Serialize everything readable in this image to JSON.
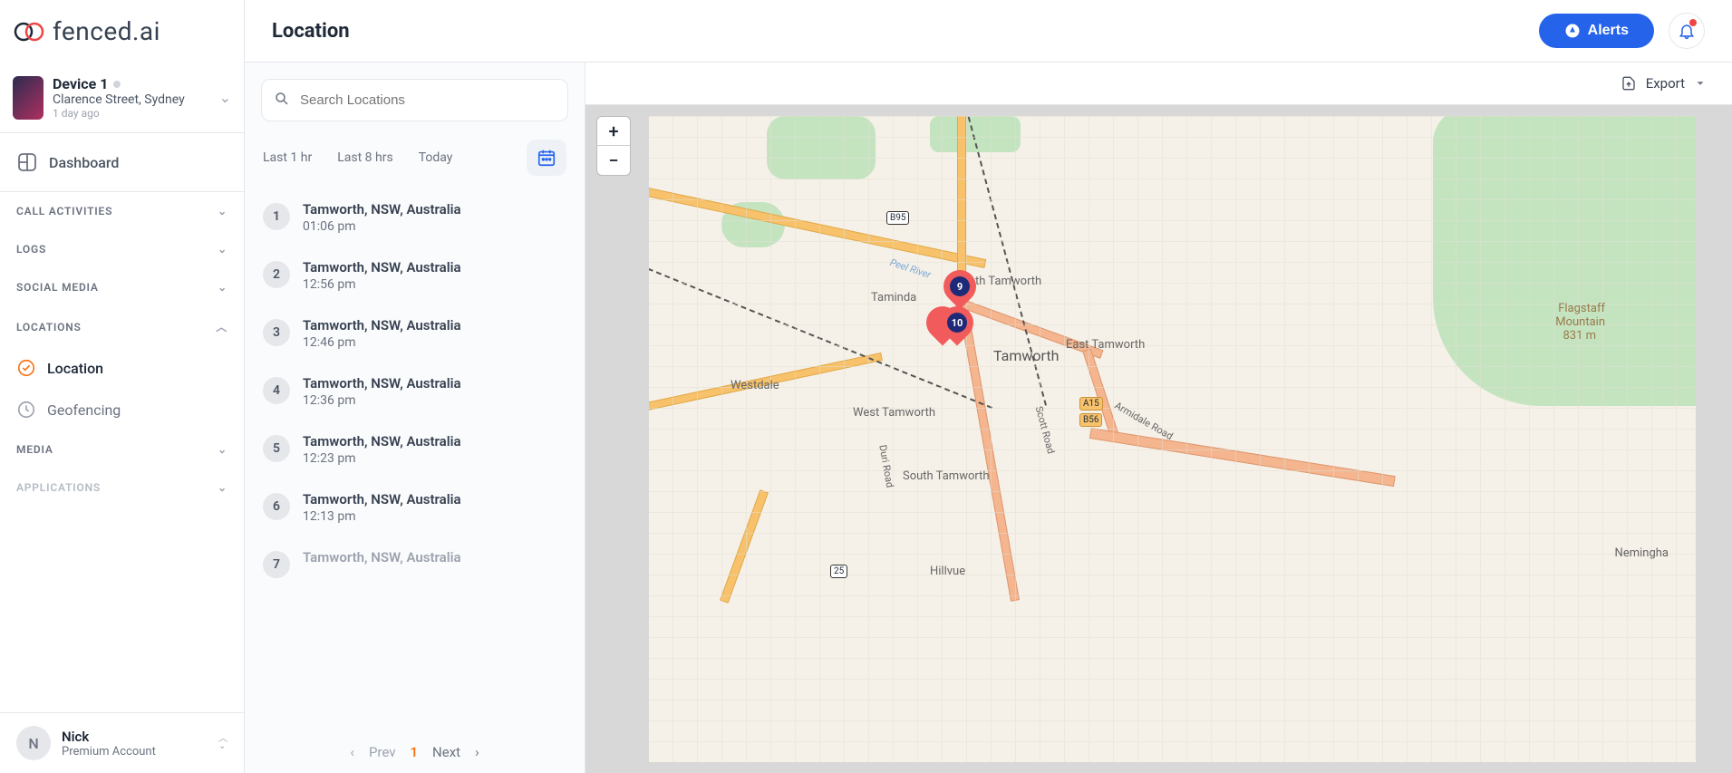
{
  "brand": "fenced.ai",
  "device": {
    "name": "Device 1",
    "location": "Clarence Street, Sydney",
    "lastSeen": "1 day ago"
  },
  "nav": {
    "dashboard": "Dashboard",
    "sections": {
      "call": "CALL ACTIVITIES",
      "logs": "LOGS",
      "social": "SOCIAL MEDIA",
      "locations": "LOCATIONS",
      "media": "MEDIA",
      "apps": "APPLICATIONS"
    },
    "sub": {
      "location": "Location",
      "geofencing": "Geofencing"
    }
  },
  "user": {
    "initial": "N",
    "name": "Nick",
    "plan": "Premium Account"
  },
  "page": {
    "title": "Location"
  },
  "topbar": {
    "alerts": "Alerts"
  },
  "search": {
    "placeholder": "Search Locations"
  },
  "filters": {
    "hr1": "Last 1 hr",
    "hr8": "Last 8 hrs",
    "today": "Today"
  },
  "locations": [
    {
      "idx": "1",
      "name": "Tamworth, NSW, Australia",
      "time": "01:06 pm"
    },
    {
      "idx": "2",
      "name": "Tamworth, NSW, Australia",
      "time": "12:56 pm"
    },
    {
      "idx": "3",
      "name": "Tamworth, NSW, Australia",
      "time": "12:46 pm"
    },
    {
      "idx": "4",
      "name": "Tamworth, NSW, Australia",
      "time": "12:36 pm"
    },
    {
      "idx": "5",
      "name": "Tamworth, NSW, Australia",
      "time": "12:23 pm"
    },
    {
      "idx": "6",
      "name": "Tamworth, NSW, Australia",
      "time": "12:13 pm"
    },
    {
      "idx": "7",
      "name": "Tamworth, NSW, Australia",
      "time": ""
    }
  ],
  "pager": {
    "prev": "Prev",
    "page": "1",
    "next": "Next"
  },
  "export": {
    "label": "Export"
  },
  "map": {
    "labels": {
      "tamworth": "Tamworth",
      "north": "th Tamworth",
      "east": "East Tamworth",
      "west": "West Tamworth",
      "south": "South Tamworth",
      "taminda": "Taminda",
      "westdale": "Westdale",
      "hillvue": "Hillvue",
      "neminga": "Nemingha",
      "flag1": "Flagstaff",
      "flag2": "Mountain",
      "flag3": "831 m",
      "scott": "Scott Road",
      "duri": "Duri Road",
      "river": "Peel River",
      "armidale": "Armidale Road"
    },
    "shields": {
      "b95": "B95",
      "r25": "25",
      "a15": "A15",
      "b56": "B56"
    },
    "pins": {
      "p9": "9",
      "p10": "10"
    }
  }
}
